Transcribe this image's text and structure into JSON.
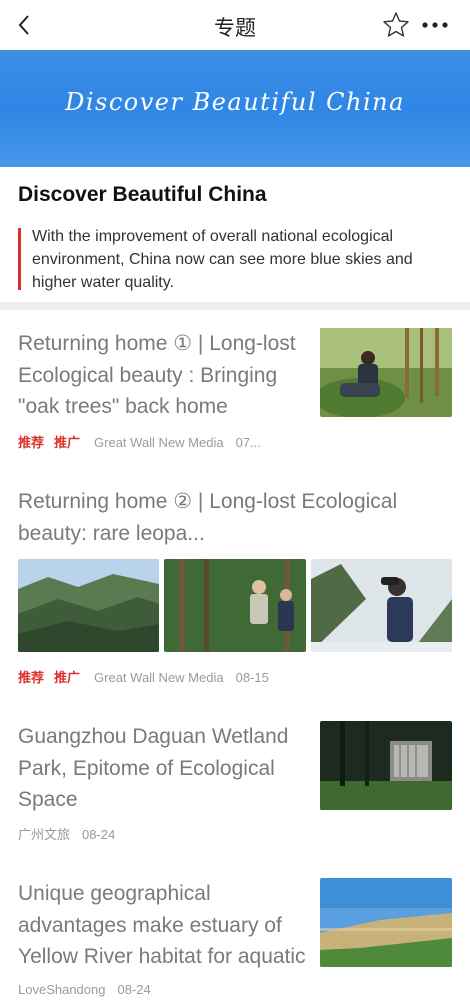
{
  "header": {
    "title": "专题",
    "back_icon": "chevron-left-icon",
    "star_icon": "star-outline-icon",
    "more_icon": "more-dots-icon"
  },
  "banner": {
    "text": "Discover Beautiful China",
    "color": "#2f86e5"
  },
  "intro": {
    "title": "Discover Beautiful China",
    "description": "With the improvement of overall national ecological environment, China now can see more blue skies and higher water quality."
  },
  "articles": [
    {
      "title": "Returning home ① | Long-lost Ecological beauty : Bringing \"oak trees\" back home",
      "tags": [
        "推荐",
        "推广"
      ],
      "source": "Great Wall New Media",
      "date": "07..."
    },
    {
      "title": "Returning home ② | Long-lost Ecological beauty: rare leopa...",
      "tags": [
        "推荐",
        "推广"
      ],
      "source": "Great Wall New Media",
      "date": "08-15"
    },
    {
      "title": "Guangzhou Daguan Wetland Park, Epitome of Ecological Space",
      "tags": [],
      "source": "广州文旅",
      "date": "08-24"
    },
    {
      "title": "Unique geographical advantages make estuary of Yellow River habitat for aquatic li...",
      "tags": [],
      "source": "LoveShandong",
      "date": "08-24"
    }
  ],
  "colors": {
    "accent_red": "#d9322b",
    "banner_blue": "#2f86e5"
  }
}
